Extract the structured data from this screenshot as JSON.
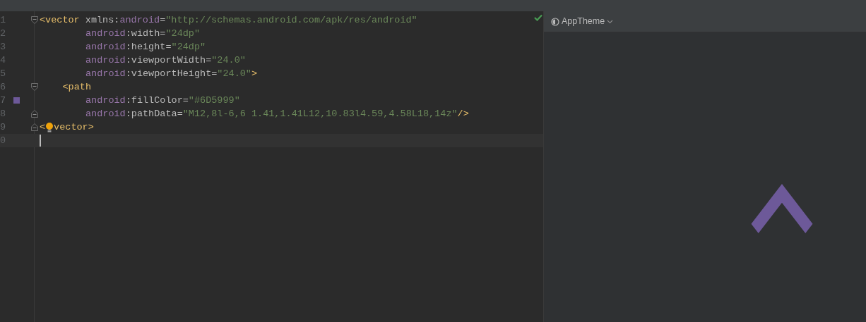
{
  "editor": {
    "valid": true,
    "lines": [
      {
        "number": "1",
        "fold_open": true,
        "current": false,
        "tokens": [
          {
            "kind": "tag",
            "text": "<vector "
          },
          {
            "kind": "attr",
            "text": "xmlns:"
          },
          {
            "kind": "ns",
            "text": "android"
          },
          {
            "kind": "attr",
            "text": "="
          },
          {
            "kind": "str",
            "text": "\"http://schemas.android.com/apk/res/android\""
          }
        ]
      },
      {
        "number": "2",
        "kind": "attribute",
        "current": false,
        "tokens": [
          {
            "kind": "ns",
            "text": "android"
          },
          {
            "kind": "attr",
            "text": ":width="
          },
          {
            "kind": "str",
            "text": "\"24dp\""
          }
        ]
      },
      {
        "number": "3",
        "kind": "attribute",
        "current": false,
        "tokens": [
          {
            "kind": "ns",
            "text": "android"
          },
          {
            "kind": "attr",
            "text": ":height="
          },
          {
            "kind": "str",
            "text": "\"24dp\""
          }
        ]
      },
      {
        "number": "4",
        "kind": "attribute",
        "current": false,
        "tokens": [
          {
            "kind": "ns",
            "text": "android"
          },
          {
            "kind": "attr",
            "text": ":viewportWidth="
          },
          {
            "kind": "str",
            "text": "\"24.0\""
          }
        ]
      },
      {
        "number": "5",
        "kind": "attribute",
        "current": false,
        "tokens": [
          {
            "kind": "ns",
            "text": "android"
          },
          {
            "kind": "attr",
            "text": ":viewportHeight="
          },
          {
            "kind": "str",
            "text": "\"24.0\""
          },
          {
            "kind": "tag",
            "text": ">"
          }
        ]
      },
      {
        "number": "6",
        "kind": "child",
        "fold_open": true,
        "current": false,
        "tokens": [
          {
            "kind": "tag",
            "text": "<path"
          }
        ]
      },
      {
        "number": "7",
        "kind": "attribute",
        "color": "#6d5999",
        "current": false,
        "tokens": [
          {
            "kind": "ns",
            "text": "android"
          },
          {
            "kind": "attr",
            "text": ":fillColor="
          },
          {
            "kind": "str",
            "text": "\"#6D5999\""
          }
        ]
      },
      {
        "number": "8",
        "kind": "attribute",
        "fold_close": true,
        "current": false,
        "tokens": [
          {
            "kind": "ns",
            "text": "android"
          },
          {
            "kind": "attr",
            "text": ":pathData="
          },
          {
            "kind": "str",
            "text": "\"M12,8l-6,6 1.41,1.41L12,10.83l4.59,4.58L18,14z\""
          },
          {
            "kind": "tag",
            "text": "/>"
          }
        ]
      },
      {
        "number": "9",
        "fold_close": true,
        "current": false,
        "tokens": [
          {
            "kind": "tag",
            "text": "<"
          },
          {
            "kind": "bulb"
          },
          {
            "kind": "tag",
            "text": "vector>"
          }
        ]
      },
      {
        "number": "0",
        "current": true
      }
    ]
  },
  "preview": {
    "theme_button": "AppTheme"
  }
}
